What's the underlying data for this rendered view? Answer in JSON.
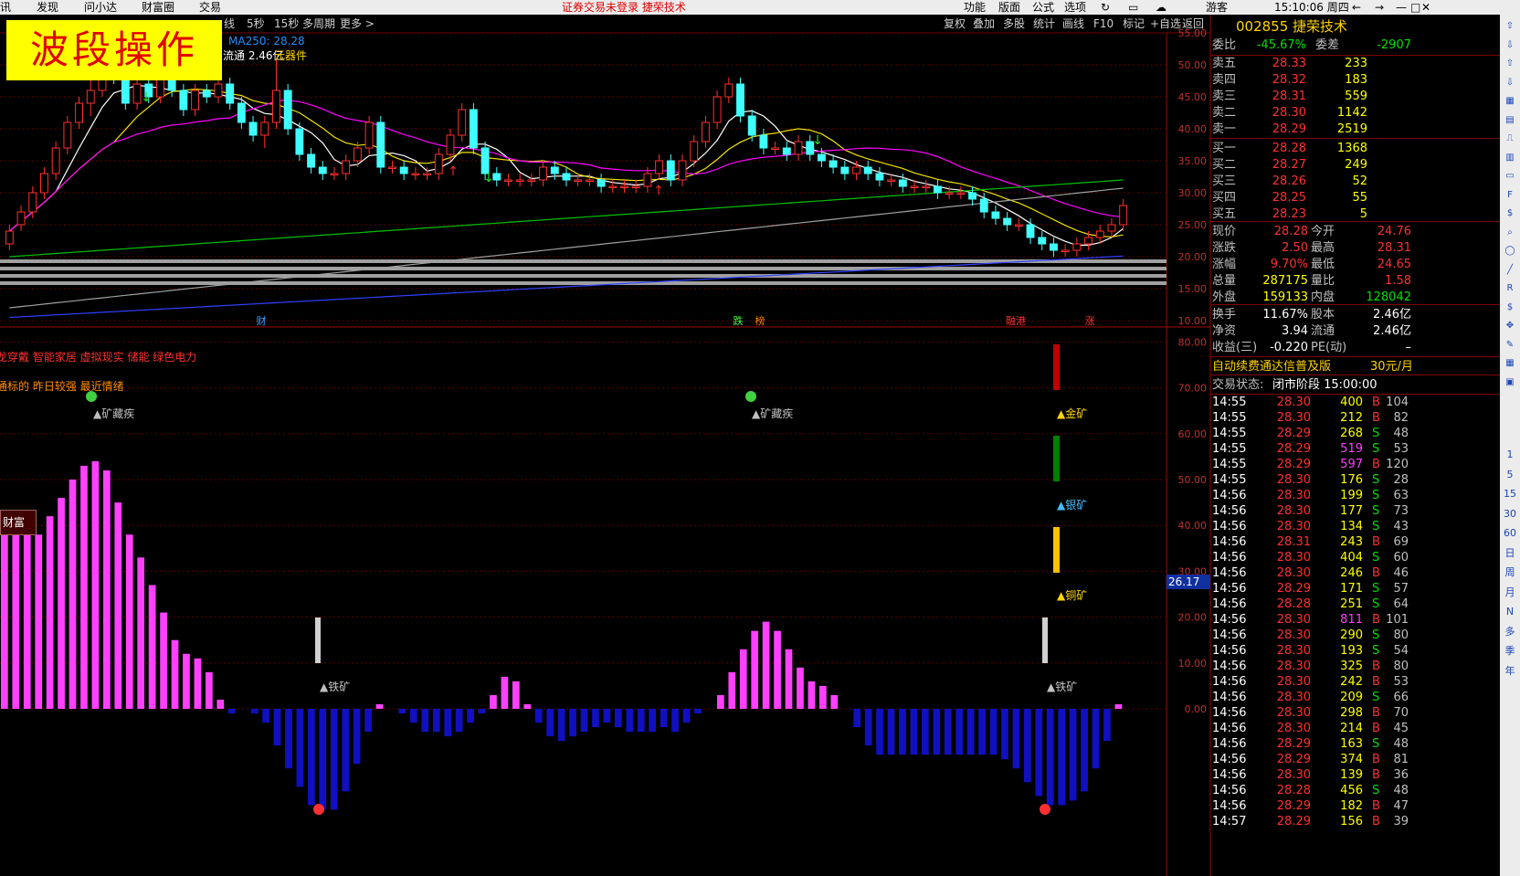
{
  "menubar": {
    "left": [
      "讯",
      "发现",
      "问小达",
      "财富圈",
      "交易"
    ],
    "center": "证券交易未登录   捷荣技术",
    "right": [
      "功能",
      "版面",
      "公式",
      "选项"
    ],
    "user": "游客",
    "clock": "15:10:06 周四"
  },
  "toolbar": {
    "periods": [
      "线",
      "5秒",
      "15秒",
      "多周期",
      "更多 >"
    ],
    "buttons": [
      "复权",
      "叠加",
      "多股",
      "统计",
      "画线",
      "F10",
      "标记",
      "+自选",
      "返回"
    ]
  },
  "overlay": {
    "banner": "波段操作",
    "ma_label": "MA250: 28.28",
    "float_label": "流通 2.46亿",
    "sector_label": "元器件"
  },
  "price_axis": [
    "55.00",
    "50.00",
    "45.00",
    "40.00",
    "35.00",
    "30.00",
    "25.00",
    "20.00",
    "15.00",
    "10.00"
  ],
  "event_marks": [
    "财",
    "跌",
    "榜",
    "融港",
    "涨"
  ],
  "indicator": {
    "line1": "龙穿戴 智能家居 虚拟现实 储能 绿色电力",
    "line2": "通标的 昨日较强 最近情绪",
    "mine_labels": [
      "▲矿藏疾",
      "▲矿藏疾",
      "▲金矿",
      "▲银矿",
      "▲铜矿",
      "▲铁矿",
      "▲铁矿"
    ],
    "fortune_tag": "财富",
    "axis": [
      "80.00",
      "70.00",
      "60.00",
      "50.00",
      "40.00",
      "30.00",
      "20.00",
      "10.00",
      "0.00"
    ],
    "current_value": "26.17",
    "bars": [
      38,
      38,
      38,
      38,
      42,
      46,
      50,
      53,
      54,
      52,
      45,
      38,
      33,
      27,
      21,
      15,
      12,
      11,
      8,
      2,
      -1,
      0,
      -1,
      -3,
      -8,
      -13,
      -17,
      -21,
      -22,
      -22,
      -18,
      -12,
      -5,
      1,
      0,
      -1,
      -3,
      -5,
      -5,
      -6,
      -5,
      -3,
      -1,
      3,
      7,
      6,
      1,
      -3,
      -6,
      -7,
      -6,
      -5,
      -4,
      -3,
      -4,
      -5,
      -5,
      -5,
      -4,
      -5,
      -3,
      -1,
      0,
      3,
      8,
      13,
      17,
      19,
      17,
      13,
      9,
      6,
      5,
      3,
      0,
      -4,
      -8,
      -10,
      -10,
      -10,
      -10,
      -10,
      -10,
      -10,
      -10,
      -10,
      -10,
      -10,
      -11,
      -13,
      -16,
      -19,
      -21,
      -21,
      -20,
      -18,
      -13,
      -7,
      1
    ]
  },
  "chart_data": {
    "type": "candlestick",
    "ohlc": [
      [
        22,
        25,
        21,
        24
      ],
      [
        25,
        28,
        24,
        27
      ],
      [
        27,
        31,
        26,
        30
      ],
      [
        30,
        34,
        29,
        33
      ],
      [
        33,
        38,
        32,
        37
      ],
      [
        37,
        42,
        36,
        41
      ],
      [
        41,
        45,
        40,
        44
      ],
      [
        44,
        48,
        42,
        46
      ],
      [
        46,
        50,
        45,
        49
      ],
      [
        49,
        52,
        47,
        48
      ],
      [
        48,
        49,
        43,
        44
      ],
      [
        44,
        48,
        43,
        47
      ],
      [
        47,
        48,
        44,
        45
      ],
      [
        45,
        49,
        44,
        48
      ],
      [
        48,
        49,
        45,
        46
      ],
      [
        46,
        47,
        42,
        43
      ],
      [
        43,
        47,
        42,
        46
      ],
      [
        46,
        47,
        44,
        45
      ],
      [
        45,
        48,
        44,
        47
      ],
      [
        47,
        48,
        43,
        44
      ],
      [
        44,
        45,
        40,
        41
      ],
      [
        41,
        42,
        38,
        39
      ],
      [
        39,
        42,
        37,
        41
      ],
      [
        41,
        51,
        40,
        46
      ],
      [
        46,
        47,
        39,
        40
      ],
      [
        40,
        41,
        35,
        36
      ],
      [
        36,
        37,
        33,
        34
      ],
      [
        34,
        35,
        32,
        33
      ],
      [
        33,
        34,
        32,
        33
      ],
      [
        33,
        36,
        32,
        35
      ],
      [
        35,
        38,
        34,
        37
      ],
      [
        37,
        42,
        36,
        41
      ],
      [
        41,
        42,
        33,
        34
      ],
      [
        34,
        35,
        33,
        34
      ],
      [
        34,
        35,
        32,
        33
      ],
      [
        33,
        34,
        32,
        33
      ],
      [
        33,
        34,
        32,
        33
      ],
      [
        33,
        37,
        32,
        36
      ],
      [
        36,
        40,
        35,
        39
      ],
      [
        39,
        44,
        38,
        43
      ],
      [
        43,
        44,
        36,
        37
      ],
      [
        37,
        38,
        32,
        33
      ],
      [
        33,
        34,
        31,
        32
      ],
      [
        32,
        33,
        31,
        32
      ],
      [
        32,
        33,
        31,
        32
      ],
      [
        32,
        33,
        31,
        32
      ],
      [
        32,
        35,
        31,
        34
      ],
      [
        34,
        35,
        32,
        33
      ],
      [
        33,
        34,
        31,
        32
      ],
      [
        32,
        33,
        31,
        32
      ],
      [
        32,
        33,
        31,
        32
      ],
      [
        32,
        33,
        30,
        31
      ],
      [
        31,
        32,
        30,
        31
      ],
      [
        31,
        32,
        30,
        31
      ],
      [
        31,
        32,
        30,
        31
      ],
      [
        31,
        34,
        30,
        33
      ],
      [
        33,
        36,
        32,
        35
      ],
      [
        35,
        36,
        31,
        32
      ],
      [
        32,
        36,
        31,
        35
      ],
      [
        35,
        39,
        34,
        38
      ],
      [
        38,
        42,
        37,
        41
      ],
      [
        41,
        46,
        40,
        45
      ],
      [
        45,
        48,
        44,
        47
      ],
      [
        47,
        48,
        41,
        42
      ],
      [
        42,
        43,
        38,
        39
      ],
      [
        39,
        40,
        36,
        37
      ],
      [
        37,
        38,
        36,
        37
      ],
      [
        37,
        38,
        35,
        36
      ],
      [
        36,
        39,
        35,
        38
      ],
      [
        38,
        39,
        35,
        36
      ],
      [
        36,
        37,
        34,
        35
      ],
      [
        35,
        36,
        33,
        34
      ],
      [
        34,
        35,
        32,
        33
      ],
      [
        33,
        35,
        32,
        34
      ],
      [
        34,
        35,
        32,
        33
      ],
      [
        33,
        34,
        31,
        32
      ],
      [
        32,
        33,
        31,
        32
      ],
      [
        32,
        33,
        30,
        31
      ],
      [
        31,
        32,
        30,
        31
      ],
      [
        31,
        32,
        30,
        31
      ],
      [
        31,
        32,
        29,
        30
      ],
      [
        30,
        31,
        29,
        30
      ],
      [
        30,
        31,
        29,
        30
      ],
      [
        30,
        31,
        28,
        29
      ],
      [
        29,
        30,
        26,
        27
      ],
      [
        27,
        28,
        25,
        26
      ],
      [
        26,
        27,
        24,
        25
      ],
      [
        25,
        26,
        24,
        25
      ],
      [
        25,
        26,
        22,
        23
      ],
      [
        23,
        24,
        21,
        22
      ],
      [
        22,
        23,
        20,
        21
      ],
      [
        21,
        22,
        20,
        21
      ],
      [
        21,
        23,
        20,
        22
      ],
      [
        22,
        24,
        21,
        23
      ],
      [
        23,
        25,
        22,
        24
      ],
      [
        24,
        26,
        23,
        25
      ],
      [
        25,
        29,
        24,
        28
      ]
    ],
    "ma_lines": [
      {
        "name": "MA5",
        "color": "#ffffff"
      },
      {
        "name": "MA10",
        "color": "#f0e000"
      },
      {
        "name": "MA20",
        "color": "#ff00ff"
      },
      {
        "name": "MA60",
        "color": "#00c000"
      },
      {
        "name": "MA120",
        "color": "#a0a0a0"
      },
      {
        "name": "MA250",
        "color": "#3040ff"
      }
    ],
    "ylim": [
      10,
      55
    ]
  },
  "quote": {
    "code": "002855",
    "name": "捷荣技术",
    "weibi": {
      "label": "委比",
      "value": "-45.67%",
      "label2": "委差",
      "value2": "-2907"
    },
    "asks": [
      {
        "label": "卖五",
        "price": "28.33",
        "vol": "233"
      },
      {
        "label": "卖四",
        "price": "28.32",
        "vol": "183"
      },
      {
        "label": "卖三",
        "price": "28.31",
        "vol": "559"
      },
      {
        "label": "卖二",
        "price": "28.30",
        "vol": "1142"
      },
      {
        "label": "卖一",
        "price": "28.29",
        "vol": "2519"
      }
    ],
    "bids": [
      {
        "label": "买一",
        "price": "28.28",
        "vol": "1368"
      },
      {
        "label": "买二",
        "price": "28.27",
        "vol": "249"
      },
      {
        "label": "买三",
        "price": "28.26",
        "vol": "52"
      },
      {
        "label": "买四",
        "price": "28.25",
        "vol": "55"
      },
      {
        "label": "买五",
        "price": "28.23",
        "vol": "5"
      }
    ],
    "stats": [
      {
        "l1": "现价",
        "v1": "28.28",
        "l2": "今开",
        "v2": "24.76"
      },
      {
        "l1": "涨跌",
        "v1": "2.50",
        "l2": "最高",
        "v2": "28.31"
      },
      {
        "l1": "涨幅",
        "v1": "9.70%",
        "l2": "最低",
        "v2": "24.65"
      },
      {
        "l1": "总量",
        "v1": "287175",
        "l2": "量比",
        "v2": "1.58"
      },
      {
        "l1": "外盘",
        "v1": "159133",
        "l2": "内盘",
        "v2": "128042"
      }
    ],
    "stats2": [
      {
        "l1": "换手",
        "v1": "11.67%",
        "l2": "股本",
        "v2": "2.46亿"
      },
      {
        "l1": "净资",
        "v1": "3.94",
        "l2": "流通",
        "v2": "2.46亿"
      },
      {
        "l1": "收益(三)",
        "v1": "-0.220",
        "l2": "PE(动)",
        "v2": "–"
      }
    ],
    "promo": "自动续费通达信普及版",
    "promo_price": "30元/月",
    "status_label": "交易状态:",
    "status_value": "闭市阶段 15:00:00"
  },
  "ticks": [
    [
      "14:55",
      "28.30",
      "400",
      "B",
      "104"
    ],
    [
      "14:55",
      "28.30",
      "212",
      "B",
      "82"
    ],
    [
      "14:55",
      "28.29",
      "268",
      "S",
      "48"
    ],
    [
      "14:55",
      "28.29",
      "519",
      "S",
      "53"
    ],
    [
      "14:55",
      "28.29",
      "597",
      "B",
      "120"
    ],
    [
      "14:55",
      "28.30",
      "176",
      "S",
      "28"
    ],
    [
      "14:56",
      "28.30",
      "199",
      "S",
      "63"
    ],
    [
      "14:56",
      "28.30",
      "177",
      "S",
      "73"
    ],
    [
      "14:56",
      "28.30",
      "134",
      "S",
      "43"
    ],
    [
      "14:56",
      "28.31",
      "243",
      "B",
      "69"
    ],
    [
      "14:56",
      "28.30",
      "404",
      "S",
      "60"
    ],
    [
      "14:56",
      "28.30",
      "246",
      "B",
      "46"
    ],
    [
      "14:56",
      "28.29",
      "171",
      "S",
      "57"
    ],
    [
      "14:56",
      "28.28",
      "251",
      "S",
      "64"
    ],
    [
      "14:56",
      "28.30",
      "811",
      "B",
      "101"
    ],
    [
      "14:56",
      "28.30",
      "290",
      "S",
      "80"
    ],
    [
      "14:56",
      "28.30",
      "193",
      "S",
      "54"
    ],
    [
      "14:56",
      "28.30",
      "325",
      "B",
      "80"
    ],
    [
      "14:56",
      "28.30",
      "242",
      "B",
      "53"
    ],
    [
      "14:56",
      "28.30",
      "209",
      "S",
      "66"
    ],
    [
      "14:56",
      "28.30",
      "298",
      "B",
      "70"
    ],
    [
      "14:56",
      "28.30",
      "214",
      "B",
      "45"
    ],
    [
      "14:56",
      "28.29",
      "163",
      "S",
      "48"
    ],
    [
      "14:56",
      "28.29",
      "374",
      "B",
      "81"
    ],
    [
      "14:56",
      "28.30",
      "139",
      "B",
      "36"
    ],
    [
      "14:56",
      "28.28",
      "456",
      "S",
      "48"
    ],
    [
      "14:56",
      "28.29",
      "182",
      "B",
      "47"
    ],
    [
      "14:57",
      "28.29",
      "156",
      "B",
      "39"
    ]
  ],
  "sidebar": [
    "1",
    "5",
    "15",
    "30",
    "60",
    "日",
    "周",
    "月",
    "N",
    "多",
    "季",
    "年"
  ],
  "colors": {
    "up": "#ff3030",
    "down": "#40ffff",
    "grid": "#800000",
    "label": "#c0c0c0",
    "yellow": "#ffd400",
    "green": "#00e000"
  }
}
